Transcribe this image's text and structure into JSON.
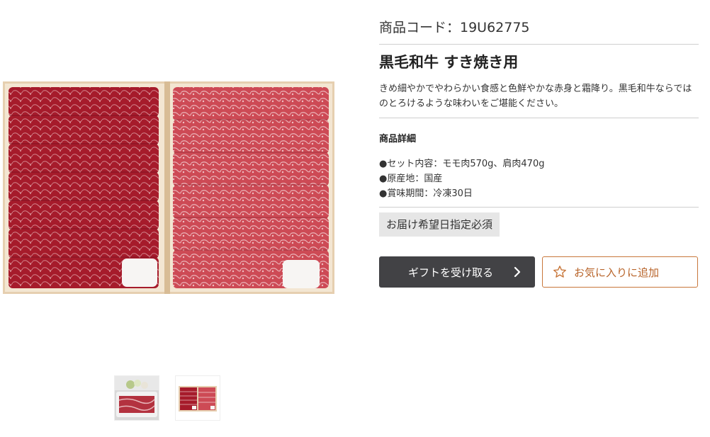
{
  "product": {
    "code_label": "商品コード：19U62775",
    "title": "黒毛和牛 すき焼き用",
    "description": "きめ細やかでやわらかい食感と色鮮やかな赤身と霜降り。黒毛和牛ならではのとろけるような味わいをご堪能ください。",
    "details_heading": "商品詳細",
    "details": [
      "●セット内容：モモ肉570g、肩肉470g",
      "●原産地：国産",
      "●賞味期間：冷凍30日"
    ],
    "delivery_badge": "お届け希望日指定必須"
  },
  "actions": {
    "gift_label": "ギフトを受け取る",
    "favorite_label": "お気に入りに追加"
  },
  "gallery": {
    "main_image": "beef-sukiyaki-box-photo",
    "thumbnails": [
      "served-sukiyaki-plate-photo",
      "beef-sukiyaki-box-photo"
    ]
  },
  "colors": {
    "gift_button_bg": "#424245",
    "favorite_border": "#c8773b",
    "favorite_text": "#b8642a",
    "badge_bg": "#e6e6e6",
    "beef_dark": "#a61b2b",
    "beef_light": "#cd4a55"
  }
}
